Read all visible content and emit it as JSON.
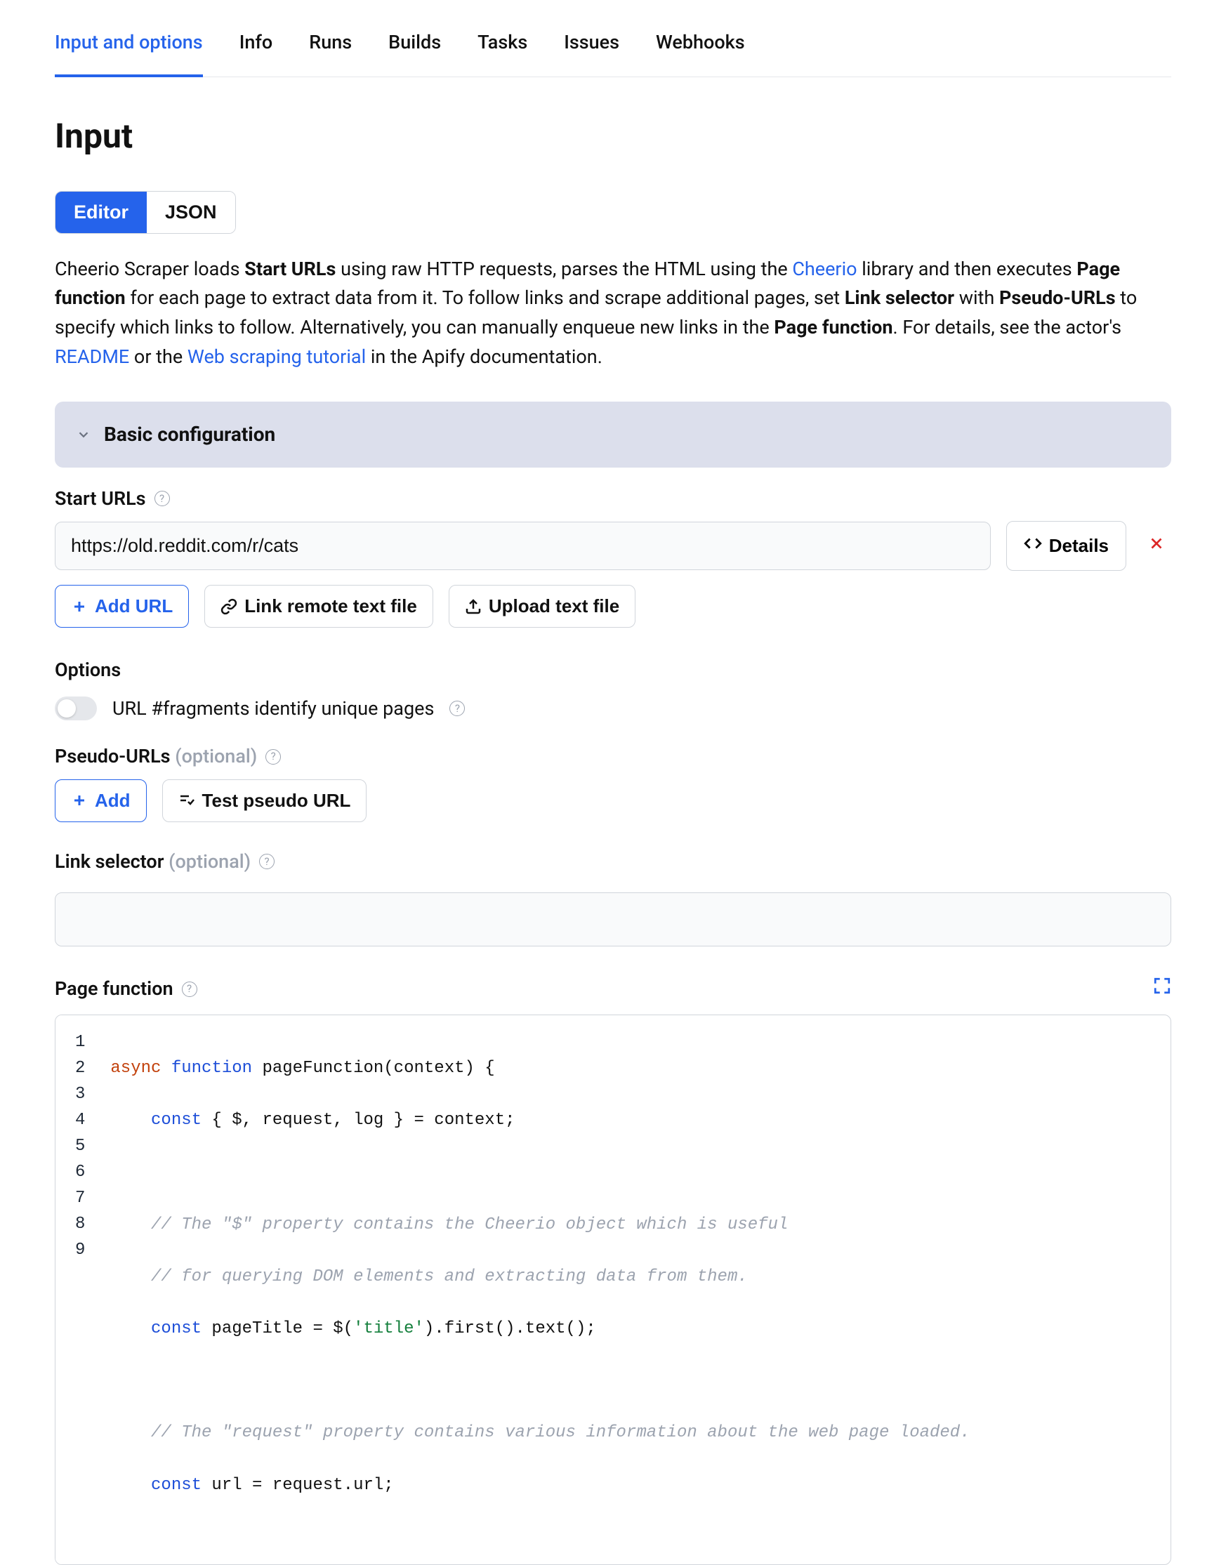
{
  "tabs": [
    "Input and options",
    "Info",
    "Runs",
    "Builds",
    "Tasks",
    "Issues",
    "Webhooks"
  ],
  "activeTabIndex": 0,
  "heading": "Input",
  "toggle": {
    "editor": "Editor",
    "json": "JSON"
  },
  "desc": {
    "p1a": "Cheerio Scraper loads ",
    "p1b": "Start URLs",
    "p1c": " using raw HTTP requests, parses the HTML using the ",
    "p1d": "Cheerio",
    "p1e": " library and then executes ",
    "p1f": "Page function",
    "p1g": " for each page to extract data from it. To follow links and scrape additional pages, set ",
    "p1h": "Link selector",
    "p1i": " with ",
    "p1j": "Pseudo-URLs",
    "p1k": " to specify which links to follow. Alternatively, you can manually enqueue new links in the ",
    "p1l": "Page function",
    "p1m": ". For details, see the actor's ",
    "p1n": "README",
    "p1o": " or the ",
    "p1p": "Web scraping tutorial",
    "p1q": " in the Apify documentation."
  },
  "section": {
    "basic": "Basic configuration"
  },
  "startUrls": {
    "label": "Start URLs",
    "value": "https://old.reddit.com/r/cats",
    "details": "Details",
    "addUrl": "Add URL",
    "linkRemote": "Link remote text file",
    "uploadFile": "Upload text file"
  },
  "options": {
    "label": "Options",
    "fragments": "URL #fragments identify unique pages"
  },
  "pseudo": {
    "label": "Pseudo-URLs ",
    "optional": "(optional)",
    "add": "Add",
    "test": "Test pseudo URL"
  },
  "linkSelector": {
    "label": "Link selector ",
    "optional": "(optional)"
  },
  "pageFn": {
    "label": "Page function",
    "code": {
      "l1": {
        "a": "async ",
        "b": "function ",
        "c": "pageFunction(context) {"
      },
      "l2": {
        "a": "    ",
        "b": "const",
        "c": " { $, request, log } = context;"
      },
      "l3": "",
      "l4": "    // The \"$\" property contains the Cheerio object which is useful",
      "l5": "    // for querying DOM elements and extracting data from them.",
      "l6": {
        "a": "    ",
        "b": "const",
        "c": " pageTitle = $(",
        "d": "'title'",
        "e": ").first().text();"
      },
      "l7": "",
      "l8": "    // The \"request\" property contains various information about the web page loaded.",
      "l9": {
        "a": "    ",
        "b": "const",
        "c": " url = request.url;"
      }
    }
  },
  "help": "?"
}
